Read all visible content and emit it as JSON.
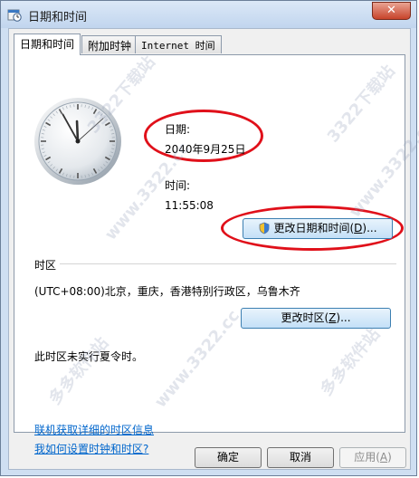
{
  "window": {
    "title": "日期和时间",
    "close_glyph": "✕",
    "icon": "clock-calendar-icon"
  },
  "tabs": [
    {
      "label": "日期和时间",
      "active": true
    },
    {
      "label": "附加时钟",
      "active": false
    },
    {
      "label": "Internet 时间",
      "active": false
    }
  ],
  "clock": {
    "hour": 11,
    "minute": 55,
    "second": 8
  },
  "date": {
    "label": "日期:",
    "value": "2040年9月25日"
  },
  "time": {
    "label": "时间:",
    "value": "11:55:08"
  },
  "change_datetime_button": {
    "label": "更改日期和时间",
    "mnemonic": "D",
    "icon": "uac-shield-icon"
  },
  "timezone": {
    "heading": "时区",
    "value": "(UTC+08:00)北京，重庆，香港特别行政区，乌鲁木齐",
    "button_label": "更改时区",
    "button_mnemonic": "Z"
  },
  "dst_note": "此时区未实行夏令时。",
  "links": [
    "联机获取详细的时区信息",
    "我如何设置时钟和时区?"
  ],
  "footer": {
    "ok": "确定",
    "cancel": "取消",
    "apply": "应用",
    "apply_mnemonic": "A"
  },
  "watermarks": [
    "3322下载站",
    "www.3322.cc",
    "多多软件站",
    "3322下载站",
    "www.3322.cc",
    "多多软件站",
    "www.3322.cc"
  ],
  "colors": {
    "highlight_ellipse": "#e0101a",
    "link": "#0066cc"
  }
}
